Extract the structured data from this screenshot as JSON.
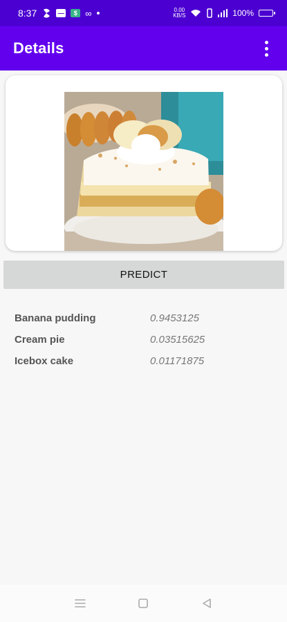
{
  "status_bar": {
    "time": "8:37",
    "network_speed": "0.00 KB/S",
    "battery": "100%"
  },
  "app_bar": {
    "title": "Details"
  },
  "actions": {
    "predict_label": "PREDICT"
  },
  "predictions": [
    {
      "label": "Banana pudding",
      "score": "0.9453125"
    },
    {
      "label": "Cream pie",
      "score": "0.03515625"
    },
    {
      "label": "Icebox cake",
      "score": "0.01171875"
    }
  ],
  "colors": {
    "status_bar": "#4b00d1",
    "app_bar": "#6200ee",
    "predict_button": "#d6d7d7",
    "background": "#f7f7f7"
  },
  "icons": {
    "overflow": "more-vert-icon",
    "nav_menu": "menu-icon",
    "nav_home": "square-icon",
    "nav_back": "back-triangle-icon"
  }
}
